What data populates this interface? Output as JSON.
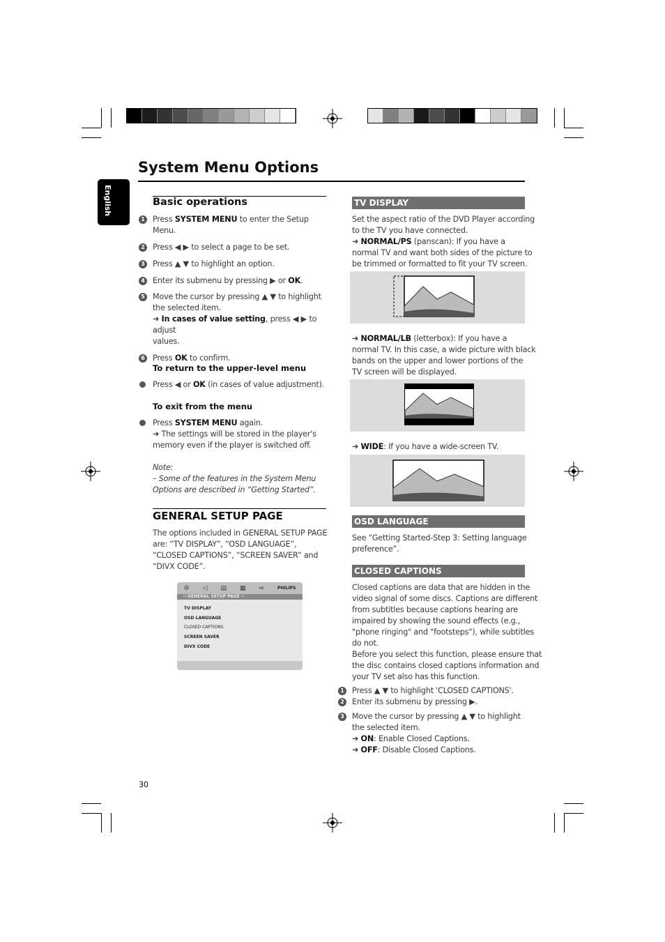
{
  "page_title": "System Menu Options",
  "language_tab": "English",
  "page_number": "30",
  "left": {
    "basic_heading": "Basic operations",
    "steps": [
      {
        "n": "1",
        "lines": [
          [
            {
              "t": "Press "
            },
            {
              "t": "SYSTEM MENU",
              "b": 1
            },
            {
              "t": " to enter the Setup"
            }
          ],
          [
            {
              "t": "Menu."
            }
          ]
        ]
      },
      {
        "n": "2",
        "lines": [
          [
            {
              "t": "Press ◀ ▶  to select a page to be set."
            }
          ]
        ]
      },
      {
        "n": "3",
        "lines": [
          [
            {
              "t": "Press ▲ ▼  to highlight an option."
            }
          ]
        ]
      },
      {
        "n": "4",
        "lines": [
          [
            {
              "t": "Enter its submenu by pressing ▶  or "
            },
            {
              "t": "OK",
              "b": 1
            },
            {
              "t": "."
            }
          ]
        ]
      },
      {
        "n": "5",
        "lines": [
          [
            {
              "t": "Move the cursor by pressing ▲ ▼  to highlight"
            }
          ],
          [
            {
              "t": "the selected item."
            }
          ],
          [
            {
              "t": "➜ "
            },
            {
              "t": "In cases of value setting",
              "b": 1
            },
            {
              "t": ", press ◀ ▶  to adjust"
            }
          ],
          [
            {
              "t": "values."
            }
          ]
        ]
      },
      {
        "n": "6",
        "lines": [
          [
            {
              "t": "Press "
            },
            {
              "t": "OK",
              "b": 1
            },
            {
              "t": " to confirm."
            }
          ]
        ]
      }
    ],
    "return_heading": "To return to the upper-level menu",
    "return_text": [
      [
        {
          "t": "Press ◀  or "
        },
        {
          "t": "OK",
          "b": 1
        },
        {
          "t": " (in cases of value adjustment)."
        }
      ]
    ],
    "exit_heading": "To exit from the menu",
    "exit_text": [
      [
        {
          "t": "Press "
        },
        {
          "t": "SYSTEM MENU",
          "b": 1
        },
        {
          "t": " again."
        }
      ],
      [
        {
          "t": "➜ The settings will be stored in the player's"
        }
      ],
      [
        {
          "t": "memory even if the player is switched off."
        }
      ]
    ],
    "note_label": "Note:",
    "note_lines": [
      "–  Some of the features in the System Menu",
      "Options are described in “Getting Started”."
    ],
    "general_heading": "GENERAL SETUP PAGE",
    "general_lines": [
      "The options included in GENERAL SETUP PAGE",
      "are: “TV DISPLAY”, “OSD LANGUAGE”,",
      "“CLOSED CAPTIONS”, “SCREEN SAVER” and",
      "“DIVX CODE”."
    ],
    "menu": {
      "brand": "PHILIPS",
      "header": "-- GENERAL SETUP PAGE --",
      "items": [
        "TV DISPLAY",
        "OSD LANGUAGE",
        "CLOSED CAPTIONS",
        "SCREEN SAVER",
        "DIVX CODE"
      ]
    }
  },
  "right": {
    "tv_display_bar": "TV DISPLAY",
    "tv_intro": [
      [
        {
          "t": "Set the aspect ratio of the DVD Player according"
        }
      ],
      [
        {
          "t": "to the TV you have connected."
        }
      ],
      [
        {
          "t": "➜ "
        },
        {
          "t": "NORMAL/PS",
          "b": 1
        },
        {
          "t": " (panscan): If you have a"
        }
      ],
      [
        {
          "t": "normal TV and want both sides of the picture to"
        }
      ],
      [
        {
          "t": "be trimmed or formatted to fit your TV screen."
        }
      ]
    ],
    "lb_text": [
      [
        {
          "t": "➜ "
        },
        {
          "t": "NORMAL/LB",
          "b": 1
        },
        {
          "t": " (letterbox): If you have a"
        }
      ],
      [
        {
          "t": "normal TV. In this case, a wide picture with black"
        }
      ],
      [
        {
          "t": "bands on the upper and lower portions of the"
        }
      ],
      [
        {
          "t": "TV screen will be displayed."
        }
      ]
    ],
    "wide_text": [
      [
        {
          "t": "➜ "
        },
        {
          "t": "WIDE",
          "b": 1
        },
        {
          "t": ": If you have a wide-screen TV."
        }
      ]
    ],
    "osd_bar": "OSD LANGUAGE",
    "osd_text": [
      [
        {
          "t": "See “Getting Started-Step 3: Setting language"
        }
      ],
      [
        {
          "t": "preference”."
        }
      ]
    ],
    "cc_bar": "CLOSED CAPTIONS",
    "cc_text": [
      [
        {
          "t": "Closed captions are data that are hidden in the"
        }
      ],
      [
        {
          "t": "video signal of some discs. Captions are different"
        }
      ],
      [
        {
          "t": "from subtitles because captions hearing are"
        }
      ],
      [
        {
          "t": "impaired by showing the sound effects (e.g.,"
        }
      ],
      [
        {
          "t": "\"phone ringing\" and \"footsteps\"), while subtitles"
        }
      ],
      [
        {
          "t": "do not."
        }
      ],
      [
        {
          "t": "Before you select this function, please ensure that"
        }
      ],
      [
        {
          "t": "the disc contains closed captions information and"
        }
      ],
      [
        {
          "t": "your TV set also has this function."
        }
      ]
    ],
    "cc_steps": [
      {
        "n": "1",
        "lines": [
          [
            {
              "t": "Press ▲ ▼  to highlight 'CLOSED CAPTIONS'."
            }
          ]
        ]
      },
      {
        "n": "2",
        "lines": [
          [
            {
              "t": "Enter its submenu by pressing ▶."
            }
          ]
        ]
      },
      {
        "n": "3",
        "lines": [
          [
            {
              "t": "Move the cursor by pressing ▲ ▼  to highlight"
            }
          ],
          [
            {
              "t": "the selected item."
            }
          ],
          [
            {
              "t": "➜ "
            },
            {
              "t": "ON",
              "b": 1
            },
            {
              "t": ": Enable Closed Captions."
            }
          ],
          [
            {
              "t": "➜ "
            },
            {
              "t": "OFF",
              "b": 1
            },
            {
              "t": ": Disable Closed Captions."
            }
          ]
        ]
      }
    ]
  },
  "colors": {
    "bar": "#6f6f6f",
    "tab": "#000000",
    "image_bg": "#dcdcdc"
  },
  "swatches_left": [
    "#000",
    "#1a1a1a",
    "#333",
    "#4d4d4d",
    "#666",
    "#808080",
    "#999",
    "#b3b3b3",
    "#ccc",
    "#e6e6e6",
    "#fff"
  ],
  "swatches_right": [
    "#e6e6e6",
    "#808080",
    "#b3b3b3",
    "#1a1a1a",
    "#4d4d4d",
    "#333",
    "#000",
    "#fff",
    "#ccc",
    "#e6e6e6",
    "#999"
  ]
}
